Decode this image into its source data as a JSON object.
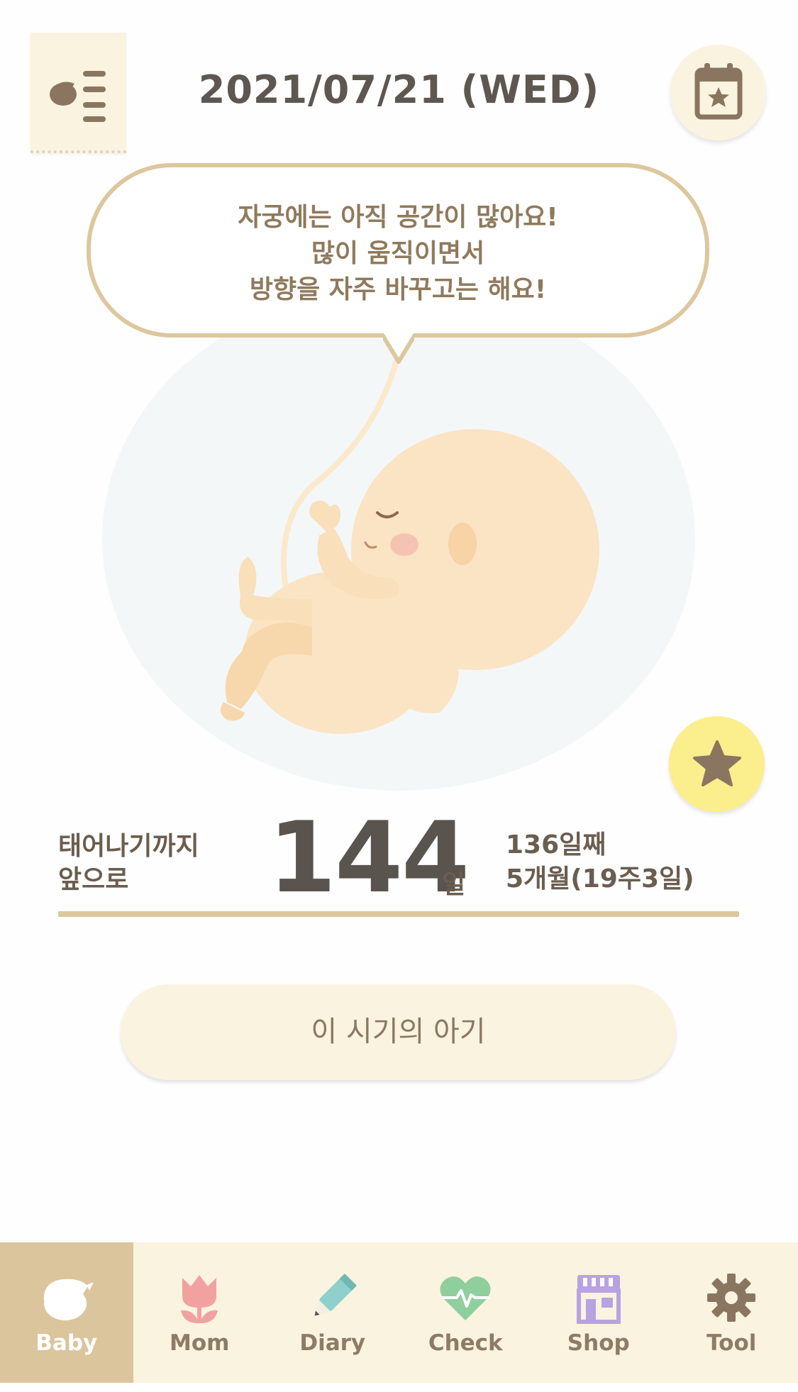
{
  "header": {
    "date": "2021/07/21 (WED)"
  },
  "bubble": {
    "lines": [
      "자궁에는 아직 공간이 많아요!",
      "많이 움직이면서",
      "방향을 자주 바꾸고는 해요!"
    ]
  },
  "countdown": {
    "label_line1": "태어나기까지",
    "label_line2": "앞으로",
    "days": "144",
    "unit": "일",
    "day_count": "136일째",
    "month_week": "5개월(19주3일)"
  },
  "period_button": {
    "label": "이 시기의 아기"
  },
  "tabs": [
    {
      "label": "Baby",
      "icon": "bird-icon",
      "active": true
    },
    {
      "label": "Mom",
      "icon": "tulip-icon",
      "active": false
    },
    {
      "label": "Diary",
      "icon": "pencil-icon",
      "active": false
    },
    {
      "label": "Check",
      "icon": "heartbeat-icon",
      "active": false
    },
    {
      "label": "Shop",
      "icon": "store-icon",
      "active": false
    },
    {
      "label": "Tool",
      "icon": "gear-icon",
      "active": false
    }
  ],
  "colors": {
    "accent": "#dcc79e",
    "cream": "#faf3df",
    "star_yellow": "#fbee8c",
    "text_brown": "#6b5d4f"
  }
}
